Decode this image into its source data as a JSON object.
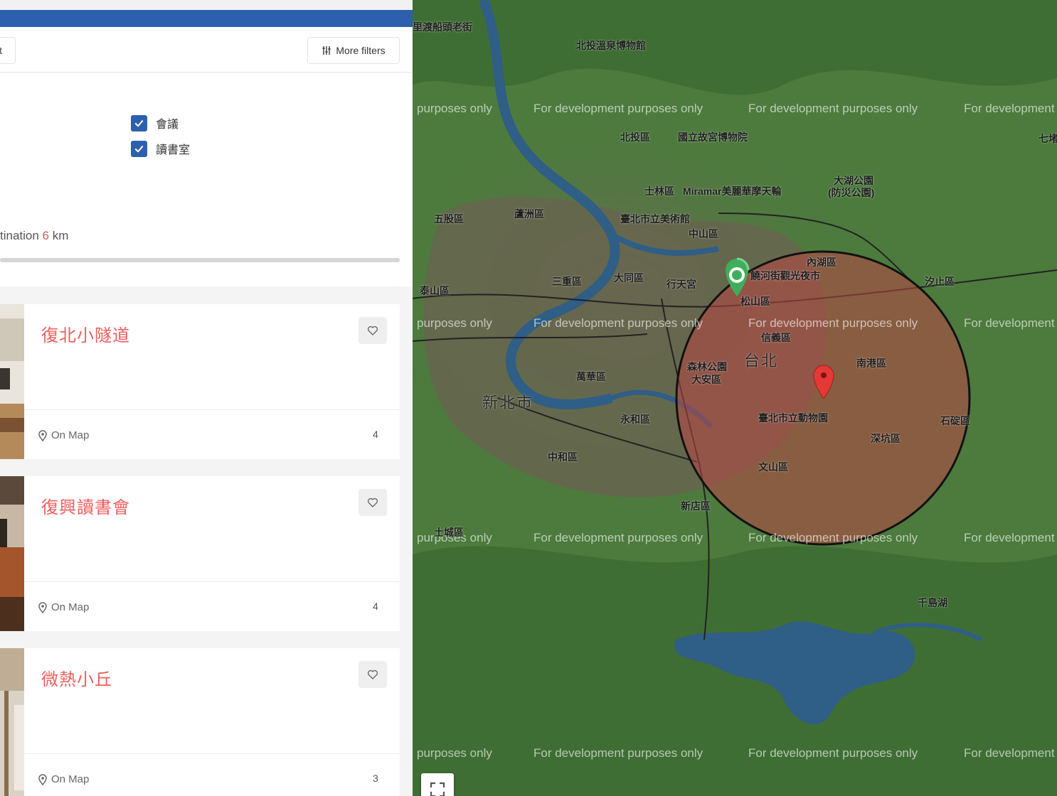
{
  "filters": {
    "left_button_label": "t",
    "more_filters_label": "More filters",
    "checkboxes": [
      {
        "label": "會議",
        "checked": true
      },
      {
        "label": "讀書室",
        "checked": true
      }
    ],
    "distance_prefix": "tination ",
    "distance_value": "6",
    "distance_unit": " km"
  },
  "listings": [
    {
      "title": "復北小隧道",
      "on_map_label": "On Map",
      "count": "4"
    },
    {
      "title": "復興讀書會",
      "on_map_label": "On Map",
      "count": "4"
    },
    {
      "title": "微熱小丘",
      "on_map_label": "On Map",
      "count": "3"
    }
  ],
  "map": {
    "watermark_text": "For development purposes only",
    "watermark_partial": "purposes only",
    "watermark_cut": "For development",
    "labels": {
      "tamsui": "里渡船頭老街",
      "beitou_museum": "北投溫泉博物館",
      "beitou": "北投區",
      "palace_museum": "國立故宮博物院",
      "shilin": "士林區",
      "miramar": "Miramar美麗華摩天輪",
      "dahu": "大湖公園",
      "dahu_sub": "(防災公園)",
      "wugu": "五股區",
      "luzhou": "蘆洲區",
      "art_museum": "臺北市立美術館",
      "zhongshan": "中山區",
      "neihu": "內湖區",
      "raohe": "饒河街觀光夜市",
      "sanchong": "三重區",
      "datong": "大同區",
      "xingtian": "行天宮",
      "songshan": "松山區",
      "xizhi": "汐止區",
      "taishan": "泰山區",
      "xinyi": "信義區",
      "taipei": "台北",
      "nangang": "南港區",
      "daan": "大安區",
      "daan_park": "森林公園",
      "wanhua": "萬華區",
      "new_taipei": "新北市",
      "zoo": "臺北市立動物園",
      "shiding": "石碇區",
      "yonghe": "永和區",
      "zhonghe": "中和區",
      "shenkeng": "深坑區",
      "wenshan": "文山區",
      "xindian": "新店區",
      "tucheng": "土城區",
      "qiandao": "千島湖",
      "qizhang": "七堵"
    }
  },
  "colors": {
    "brand_blue": "#2c5fae",
    "title_red": "#ef5d5d",
    "radius_fill": "rgba(185,70,70,0.55)",
    "pin_red": "#e53935",
    "pin_green": "#3fae5a"
  }
}
